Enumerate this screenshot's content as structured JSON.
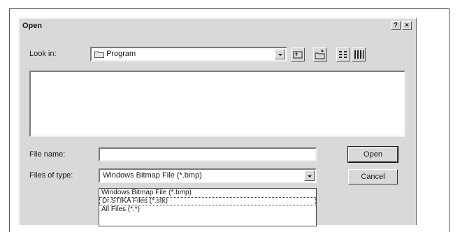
{
  "dialog": {
    "title": "Open",
    "help_btn": "?",
    "close_btn": "×"
  },
  "look_in": {
    "label": "Look in:",
    "value": "Program"
  },
  "file_name": {
    "label": "File name:",
    "value": ""
  },
  "files_of_type": {
    "label": "Files of type:",
    "value": "Windows Bitmap File (*.bmp)",
    "options": [
      "Windows Bitmap File (*.bmp)",
      "Dr.STIKA Files (*.stk)",
      "All Files (*.*)"
    ]
  },
  "buttons": {
    "open": "Open",
    "cancel": "Cancel"
  }
}
